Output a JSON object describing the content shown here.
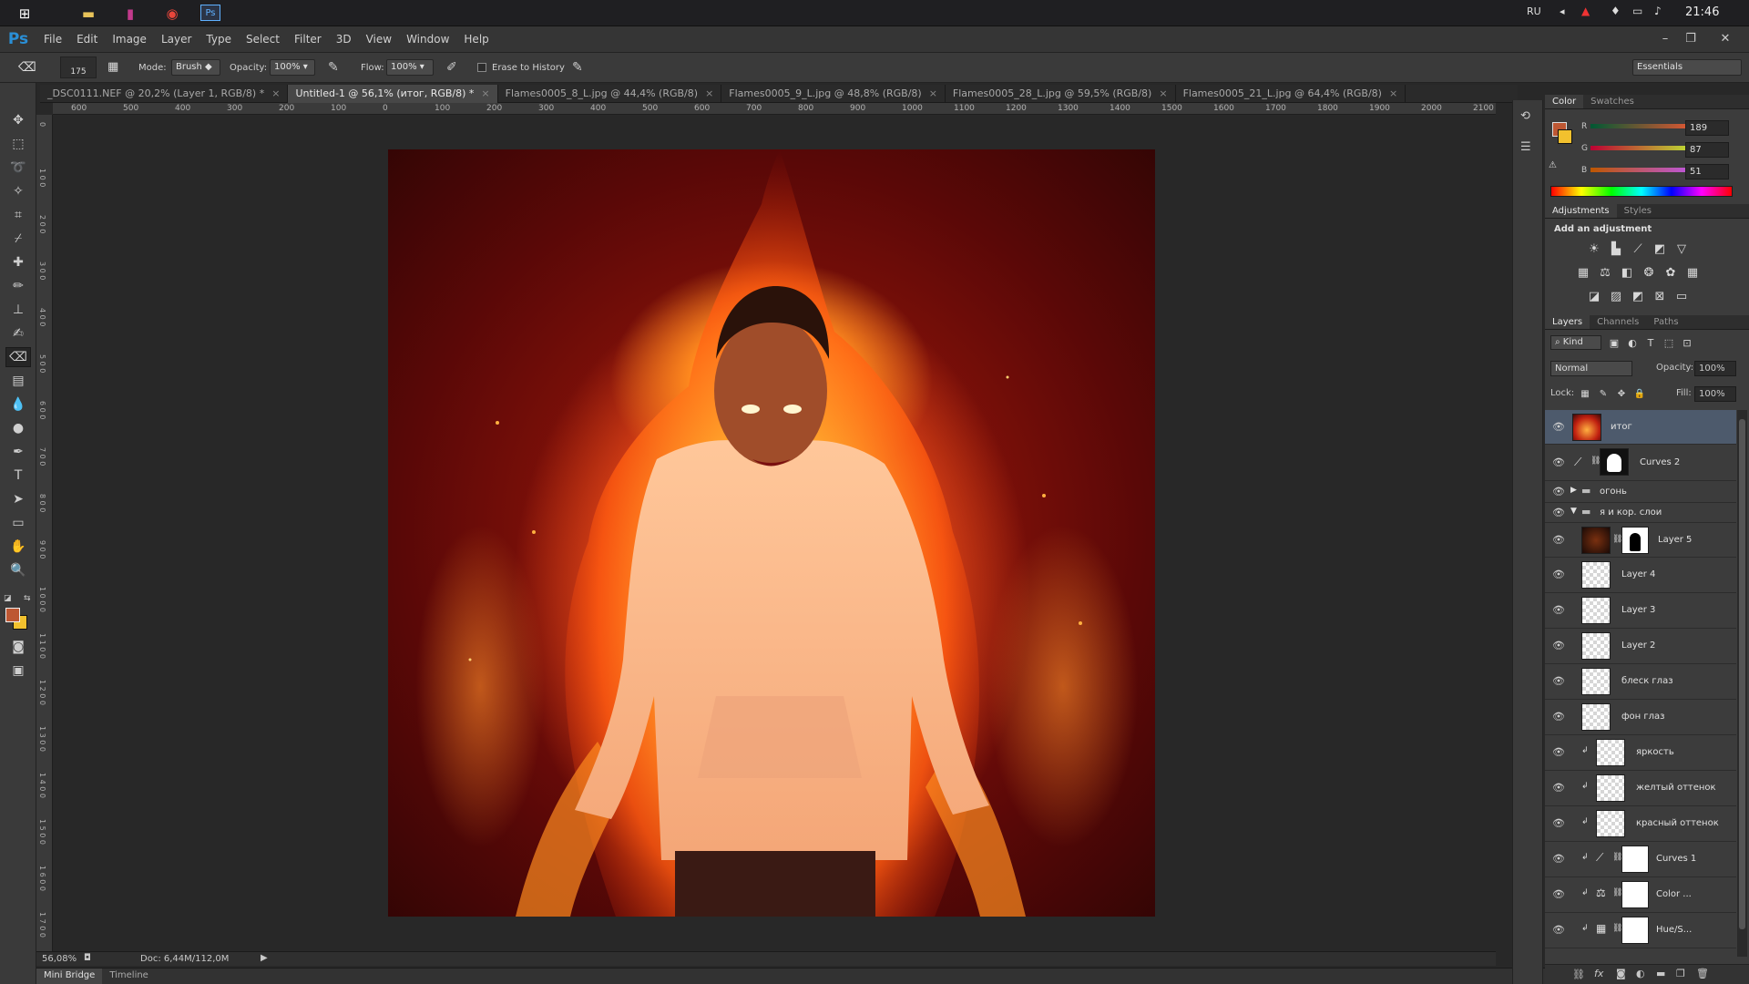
{
  "taskbar": {
    "icons": [
      "windows-icon",
      "file-explorer-icon",
      "winrar-icon",
      "chrome-icon",
      "photoshop-taskbar-icon"
    ],
    "language": "RU",
    "clock": "21:46"
  },
  "app": {
    "logo": "Ps"
  },
  "menu": [
    "File",
    "Edit",
    "Image",
    "Layer",
    "Type",
    "Select",
    "Filter",
    "3D",
    "View",
    "Window",
    "Help"
  ],
  "options": {
    "brush_size": "175",
    "mode_label": "Mode:",
    "mode_value": "Brush",
    "opacity_label": "Opacity:",
    "opacity_value": "100%",
    "flow_label": "Flow:",
    "flow_value": "100%",
    "erase_history_label": "Erase to History",
    "workspace": "Essentials"
  },
  "tabs": [
    {
      "label": "_DSC0111.NEF @ 20,2% (Layer 1, RGB/8) *",
      "active": false
    },
    {
      "label": "Untitled-1 @ 56,1% (итог, RGB/8) *",
      "active": true
    },
    {
      "label": "Flames0005_8_L.jpg @ 44,4% (RGB/8)",
      "active": false
    },
    {
      "label": "Flames0005_9_L.jpg @ 48,8% (RGB/8)",
      "active": false
    },
    {
      "label": "Flames0005_28_L.jpg @ 59,5% (RGB/8)",
      "active": false
    },
    {
      "label": "Flames0005_21_L.jpg @ 64,4% (RGB/8)",
      "active": false
    }
  ],
  "ruler_h": [
    "600",
    "500",
    "400",
    "300",
    "200",
    "100",
    "0",
    "100",
    "200",
    "300",
    "400",
    "500",
    "600",
    "700",
    "800",
    "900",
    "1000",
    "1100",
    "1200",
    "1300",
    "1400",
    "1500",
    "1600",
    "1700",
    "1800",
    "1900",
    "2000",
    "2100"
  ],
  "ruler_v": [
    "0",
    "1 0 0",
    "2 0 0",
    "3 0 0",
    "4 0 0",
    "5 0 0",
    "6 0 0",
    "7 0 0",
    "8 0 0",
    "9 0 0",
    "1 0 0 0",
    "1 1 0 0",
    "1 2 0 0",
    "1 3 0 0",
    "1 4 0 0",
    "1 5 0 0",
    "1 6 0 0",
    "1 7 0 0"
  ],
  "status": {
    "zoom": "56,08%",
    "doc": "Doc: 6,44M/112,0M"
  },
  "bottom_tabs": [
    "Mini Bridge",
    "Timeline"
  ],
  "color_panel": {
    "tabs": [
      "Color",
      "Swatches"
    ],
    "r_label": "R",
    "r_value": "189",
    "g_label": "G",
    "g_value": "87",
    "b_label": "B",
    "b_value": "51",
    "foreground": "#bd5733",
    "background": "#f2c12e"
  },
  "adjustments": {
    "tabs": [
      "Adjustments",
      "Styles"
    ],
    "title": "Add an adjustment"
  },
  "layers_panel": {
    "tabs": [
      "Layers",
      "Channels",
      "Paths"
    ],
    "filter_kind": "Kind",
    "blend_mode": "Normal",
    "opacity_label": "Opacity:",
    "opacity_value": "100%",
    "lock_label": "Lock:",
    "fill_label": "Fill:",
    "fill_value": "100%",
    "layers": [
      {
        "name": "итог",
        "type": "image",
        "selected": true
      },
      {
        "name": "Curves 2",
        "type": "adjustment"
      },
      {
        "name": "огонь",
        "type": "group-collapsed"
      },
      {
        "name": "я и кор. слои",
        "type": "group-open"
      },
      {
        "name": "Layer 5",
        "type": "masked"
      },
      {
        "name": "Layer 4",
        "type": "pixel"
      },
      {
        "name": "Layer 3",
        "type": "pixel"
      },
      {
        "name": "Layer 2",
        "type": "pixel"
      },
      {
        "name": "блеск глаз",
        "type": "pixel"
      },
      {
        "name": "фон глаз",
        "type": "pixel"
      },
      {
        "name": "яркость",
        "type": "clipped"
      },
      {
        "name": "желтый оттенок",
        "type": "clipped"
      },
      {
        "name": "красный оттенок",
        "type": "clipped"
      },
      {
        "name": "Curves 1",
        "type": "clipped-adjustment"
      },
      {
        "name": "Color ...",
        "type": "clipped-adjustment"
      },
      {
        "name": "Hue/S...",
        "type": "clipped-adjustment"
      }
    ]
  }
}
